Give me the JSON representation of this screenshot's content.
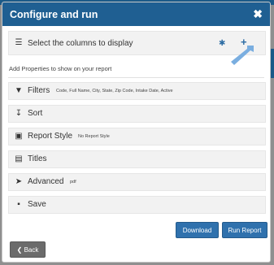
{
  "dialog": {
    "title": "Configure and run",
    "close_glyph": "✖"
  },
  "columns_row": {
    "label": "Select the columns to display",
    "icon": "list-icon",
    "actions": [
      "gear-icon",
      "plus-icon"
    ]
  },
  "hint": "Add Properties to show on your report",
  "sections": [
    {
      "label": "Filters",
      "icon": "filter-icon",
      "detail": "Code, Full Name, City, State, Zip Code, Intake Date, Active"
    },
    {
      "label": "Sort",
      "icon": "sort-icon",
      "detail": ""
    },
    {
      "label": "Report Style",
      "icon": "image-icon",
      "detail": "No Report Style"
    },
    {
      "label": "Titles",
      "icon": "document-icon",
      "detail": ""
    },
    {
      "label": "Advanced",
      "icon": "paper-plane-icon",
      "detail": "pdf"
    },
    {
      "label": "Save",
      "icon": "save-icon",
      "detail": ""
    }
  ],
  "buttons": {
    "download": "Download",
    "run_report": "Run Report",
    "back": "Back"
  },
  "colors": {
    "titlebar": "#1f5f92",
    "primary_button": "#2f71ad",
    "back_button": "#6b6b6b",
    "accent_arrow": "#7aaee0"
  }
}
